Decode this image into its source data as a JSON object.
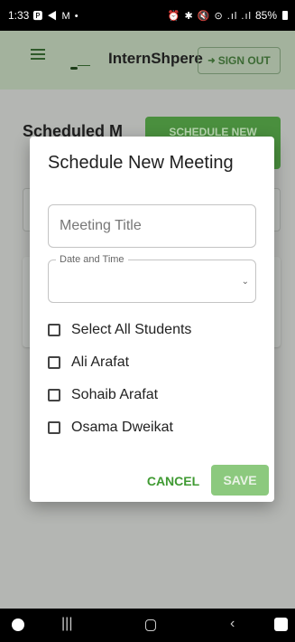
{
  "status_bar": {
    "time": "1:33",
    "notification_icons": "🅿 ◀ M •",
    "system_icons": "⏰ ✱ 🔇 ⊙ .ıl .ıl",
    "battery_percent": "85%"
  },
  "app_bar": {
    "brand": "InternShpere",
    "signout_label": "SIGN OUT",
    "menu_icon": "menu-icon",
    "logo_icon": "logo-icon"
  },
  "page": {
    "heading": "Scheduled M",
    "schedule_button_label": "SCHEDULE NEW"
  },
  "dialog": {
    "title": "Schedule New Meeting",
    "meeting_title_placeholder": "Meeting Title",
    "meeting_title_value": "",
    "datetime_label": "Date and Time",
    "datetime_value": "",
    "checkboxes": [
      {
        "label": "Select All Students",
        "checked": false
      },
      {
        "label": "Ali Arafat",
        "checked": false
      },
      {
        "label": "Sohaib Arafat",
        "checked": false
      },
      {
        "label": "Osama Dweikat",
        "checked": false
      }
    ],
    "cancel_label": "CANCEL",
    "save_label": "SAVE"
  },
  "colors": {
    "accent_green": "#3f9a32",
    "save_disabled": "#8cc97e",
    "scrim": "#b4b6b3"
  }
}
